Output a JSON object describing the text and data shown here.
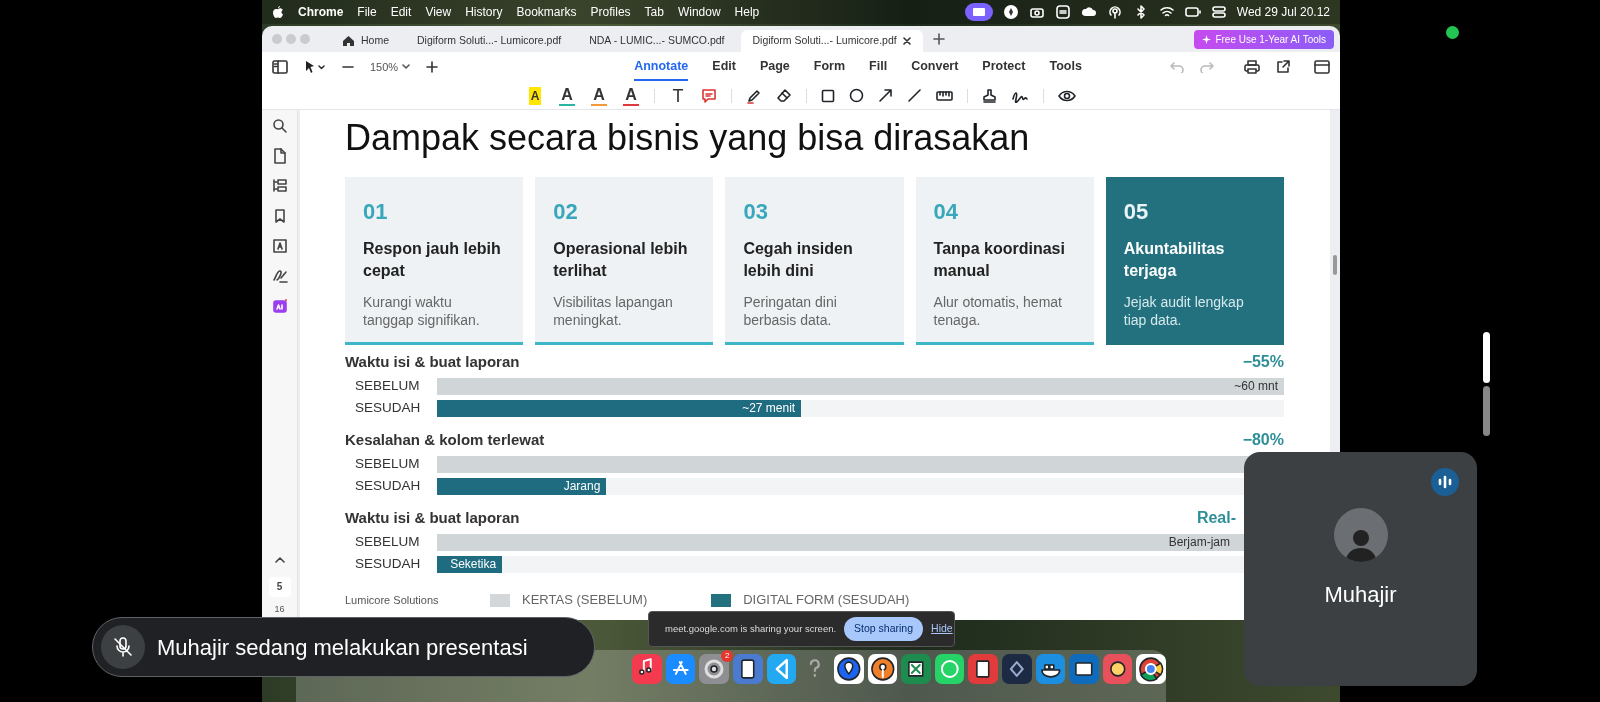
{
  "menu_bar": {
    "app": "Chrome",
    "menus": [
      "File",
      "Edit",
      "View",
      "History",
      "Bookmarks",
      "Profiles",
      "Tab",
      "Window",
      "Help"
    ],
    "clock": "Wed 29 Jul  20.12"
  },
  "tabs": [
    {
      "label": "Home",
      "kind": "home",
      "selected": false
    },
    {
      "label": "Digiform Soluti...- Lumicore.pdf",
      "kind": "file",
      "selected": false
    },
    {
      "label": "NDA - LUMIC...- SUMCO.pdf",
      "kind": "file",
      "selected": false
    },
    {
      "label": "Digiform Soluti...- Lumicore.pdf",
      "kind": "file",
      "selected": true
    }
  ],
  "promo_button": "Free Use 1-Year AI Tools",
  "zoom": "150%",
  "modes": [
    {
      "label": "Annotate",
      "selected": true
    },
    {
      "label": "Edit",
      "selected": false
    },
    {
      "label": "Page",
      "selected": false
    },
    {
      "label": "Form",
      "selected": false
    },
    {
      "label": "Fill",
      "selected": false
    },
    {
      "label": "Convert",
      "selected": false
    },
    {
      "label": "Protect",
      "selected": false
    },
    {
      "label": "Tools",
      "selected": false
    }
  ],
  "annotation_tools": [
    {
      "kind": "highlight",
      "glyph": "A",
      "color": "#ffe600"
    },
    {
      "kind": "underline",
      "glyph": "A",
      "color": "#2bb5a5"
    },
    {
      "kind": "underline",
      "glyph": "A",
      "color": "#f29a38"
    },
    {
      "kind": "strike",
      "glyph": "A",
      "color": "#e0383e"
    },
    {
      "kind": "text",
      "glyph": "T"
    },
    {
      "kind": "comment"
    },
    {
      "kind": "pen"
    },
    {
      "kind": "eraser"
    },
    {
      "kind": "rectangle"
    },
    {
      "kind": "circle"
    },
    {
      "kind": "arrow"
    },
    {
      "kind": "line"
    },
    {
      "kind": "measure"
    },
    {
      "kind": "stamp"
    },
    {
      "kind": "signature"
    },
    {
      "kind": "eye"
    }
  ],
  "sidebar": {
    "current_page": "5",
    "total_pages": "16"
  },
  "slide": {
    "title": "Dampak secara bisnis yang bisa dirasakan",
    "cards": [
      {
        "number": "01",
        "title": "Respon jauh lebih cepat",
        "text": "Kurangi waktu tanggap signifikan.",
        "highlighted": false
      },
      {
        "number": "02",
        "title": "Operasional lebih terlihat",
        "text": "Visibilitas lapangan meningkat.",
        "highlighted": false
      },
      {
        "number": "03",
        "title": "Cegah insiden lebih dini",
        "text": "Peringatan dini berbasis data.",
        "highlighted": false
      },
      {
        "number": "04",
        "title": "Tanpa koordinasi manual",
        "text": "Alur otomatis, hemat tenaga.",
        "highlighted": false
      },
      {
        "number": "05",
        "title": "Akuntabilitas terjaga",
        "text": "Jejak audit lengkap tiap data.",
        "highlighted": true
      }
    ],
    "metrics": [
      {
        "title": "Waktu isi & buat laporan",
        "change": "−55%",
        "rows": [
          {
            "kind": "before",
            "label": "SEBELUM",
            "value": "~60 mnt",
            "level": 1
          },
          {
            "kind": "after",
            "label": "SESUDAH",
            "value": "~27 menit",
            "level": 0.43
          }
        ]
      },
      {
        "title": "Kesalahan & kolom terlewat",
        "change": "−80%",
        "rows": [
          {
            "kind": "before",
            "label": "SEBELUM",
            "level": 1
          },
          {
            "kind": "after",
            "label": "SESUDAH",
            "value": "Jarang",
            "level": 0.2
          }
        ]
      },
      {
        "title": "Waktu isi & buat laporan",
        "change": "Real-",
        "rows": [
          {
            "kind": "before",
            "label": "SEBELUM",
            "value": "Berjam-jam",
            "level": 1
          },
          {
            "kind": "after",
            "label": "SESUDAH",
            "value": "Seketika",
            "level": 0.077
          }
        ]
      }
    ],
    "legend": {
      "brand": "Lumicore Solutions",
      "items": [
        {
          "label": "KERTAS (SEBELUM)",
          "color": "#d3d7da"
        },
        {
          "label": "DIGITAL FORM (SESUDAH)",
          "color": "#23717f"
        }
      ]
    }
  },
  "presenting_notice": "Muhajir sedang melakukan presentasi",
  "share_bar": {
    "message": "meet.google.com is sharing your screen.",
    "stop": "Stop sharing",
    "hide": "Hide"
  },
  "participant": {
    "name": "Muhajir"
  },
  "dock": {
    "badge": "2"
  }
}
